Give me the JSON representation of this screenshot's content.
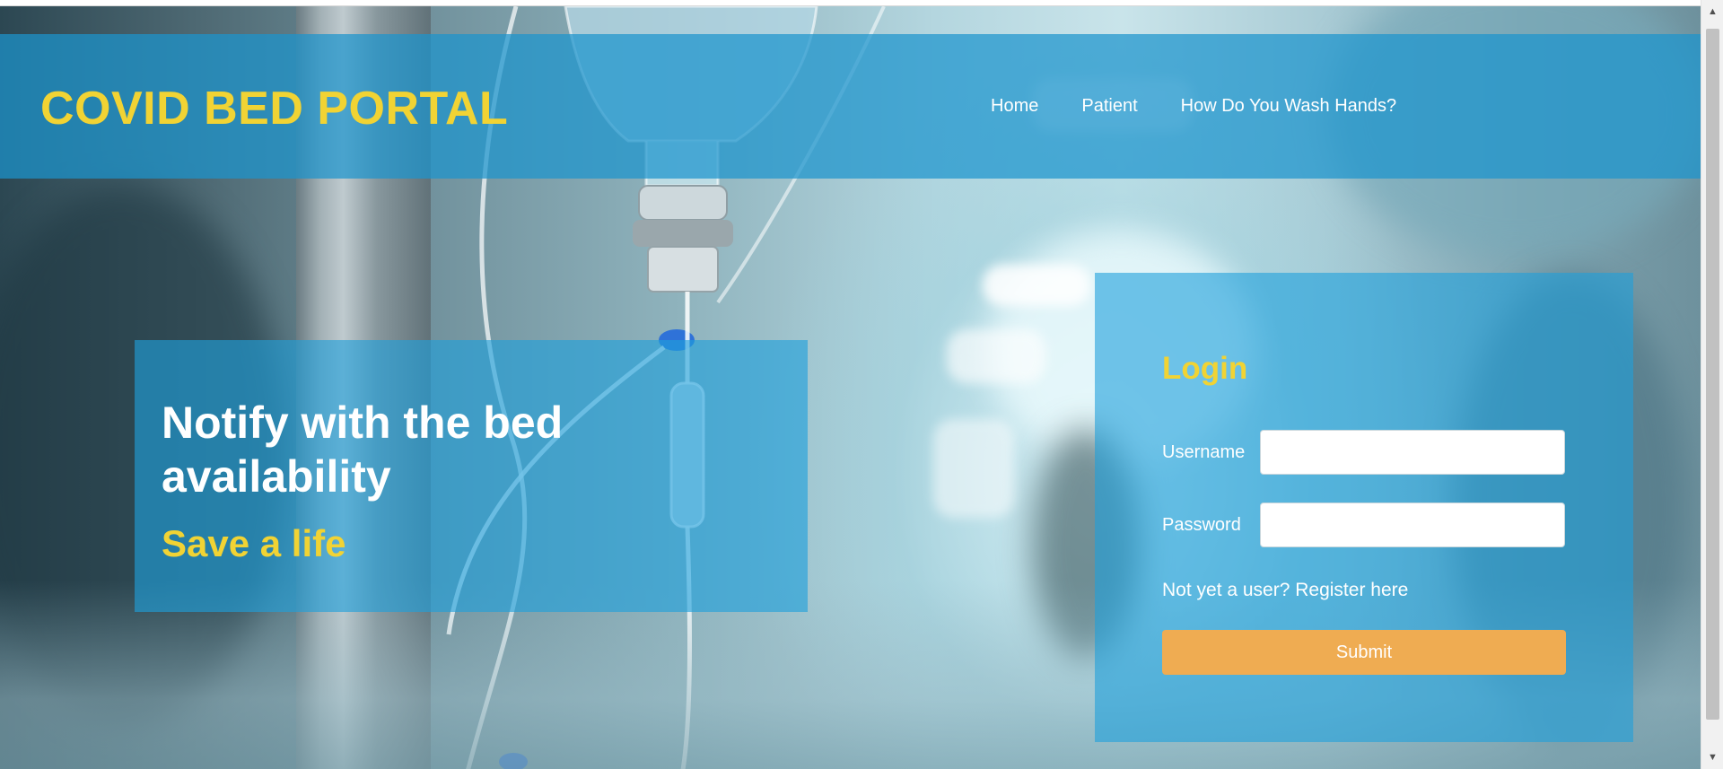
{
  "header": {
    "brand": "COVID BED PORTAL",
    "nav": [
      {
        "label": "Home"
      },
      {
        "label": "Patient"
      },
      {
        "label": "How Do You Wash Hands?"
      }
    ]
  },
  "hero": {
    "title": "Notify with the bed availability",
    "subtitle": "Save a life"
  },
  "login": {
    "title": "Login",
    "username_label": "Username",
    "username_value": "",
    "password_label": "Password",
    "password_value": "",
    "register_text": "Not yet a user? Register here",
    "submit_label": "Submit"
  },
  "colors": {
    "header_bg": "#1c94cd",
    "brand_yellow": "#f1d334",
    "submit_orange": "#efac52",
    "panel_blue": "#1ea0dc"
  },
  "icons": {
    "scroll_up": "scroll-up-arrow-icon",
    "scroll_down": "scroll-down-arrow-icon"
  }
}
